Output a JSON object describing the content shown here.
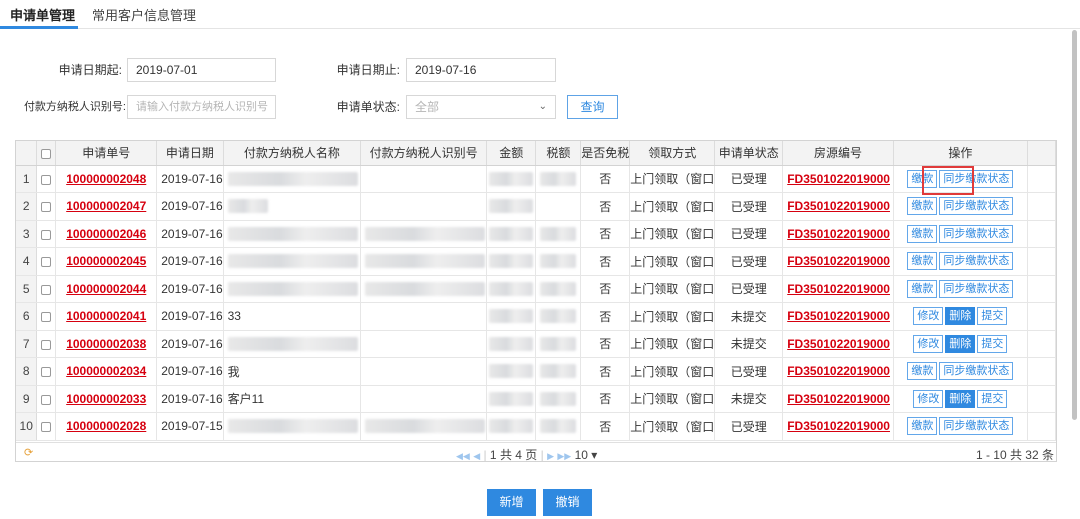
{
  "tabs": [
    {
      "label": "申请单管理",
      "active": true
    },
    {
      "label": "常用客户信息管理",
      "active": false
    }
  ],
  "form": {
    "start_date_label": "申请日期起:",
    "start_date_value": "2019-07-01",
    "end_date_label": "申请日期止:",
    "end_date_value": "2019-07-16",
    "taxpayer_id_label": "付款方纳税人识别号:",
    "taxpayer_id_placeholder": "请输入付款方纳税人识别号",
    "status_label": "申请单状态:",
    "status_value": "全部",
    "query_button": "查询"
  },
  "table": {
    "columns": [
      "申请单号",
      "申请日期",
      "付款方纳税人名称",
      "付款方纳税人识别号",
      "金额",
      "税额",
      "是否免税",
      "领取方式",
      "申请单状态",
      "房源编号",
      "操作"
    ],
    "rows": [
      {
        "n": "1",
        "id": "100000002048",
        "date": "2019-07-16",
        "name": "",
        "exempt": "否",
        "method": "上门领取（窗口",
        "status": "已受理",
        "house": "FD3501022019000",
        "actions": [
          "缴款",
          "同步缴款状态"
        ]
      },
      {
        "n": "2",
        "id": "100000002047",
        "date": "2019-07-16",
        "name": "",
        "exempt": "否",
        "method": "上门领取（窗口",
        "status": "已受理",
        "house": "FD3501022019000",
        "actions": [
          "缴款",
          "同步缴款状态"
        ]
      },
      {
        "n": "3",
        "id": "100000002046",
        "date": "2019-07-16",
        "name": "",
        "exempt": "否",
        "method": "上门领取（窗口",
        "status": "已受理",
        "house": "FD3501022019000",
        "actions": [
          "缴款",
          "同步缴款状态"
        ]
      },
      {
        "n": "4",
        "id": "100000002045",
        "date": "2019-07-16",
        "name": "",
        "exempt": "否",
        "method": "上门领取（窗口",
        "status": "已受理",
        "house": "FD3501022019000",
        "actions": [
          "缴款",
          "同步缴款状态"
        ]
      },
      {
        "n": "5",
        "id": "100000002044",
        "date": "2019-07-16",
        "name": "",
        "exempt": "否",
        "method": "上门领取（窗口",
        "status": "已受理",
        "house": "FD3501022019000",
        "actions": [
          "缴款",
          "同步缴款状态"
        ]
      },
      {
        "n": "6",
        "id": "100000002041",
        "date": "2019-07-16",
        "name": "33",
        "exempt": "否",
        "method": "上门领取（窗口",
        "status": "未提交",
        "house": "FD3501022019000",
        "actions": [
          "修改",
          "删除",
          "提交"
        ]
      },
      {
        "n": "7",
        "id": "100000002038",
        "date": "2019-07-16",
        "name": "",
        "exempt": "否",
        "method": "上门领取（窗口",
        "status": "未提交",
        "house": "FD3501022019000",
        "actions": [
          "修改",
          "删除",
          "提交"
        ]
      },
      {
        "n": "8",
        "id": "100000002034",
        "date": "2019-07-16",
        "name": "我",
        "exempt": "否",
        "method": "上门领取（窗口",
        "status": "已受理",
        "house": "FD3501022019000",
        "actions": [
          "缴款",
          "同步缴款状态"
        ]
      },
      {
        "n": "9",
        "id": "100000002033",
        "date": "2019-07-16",
        "name": "客户11",
        "exempt": "否",
        "method": "上门领取（窗口",
        "status": "未提交",
        "house": "FD3501022019000",
        "actions": [
          "修改",
          "删除",
          "提交"
        ]
      },
      {
        "n": "10",
        "id": "100000002028",
        "date": "2019-07-15",
        "name": "",
        "exempt": "否",
        "method": "上门领取（窗口",
        "status": "已受理",
        "house": "FD3501022019000",
        "actions": [
          "缴款",
          "同步缴款状态"
        ]
      }
    ]
  },
  "pager": {
    "current_page": "1",
    "total_pages_text": "共 4 页",
    "page_size": "10",
    "range_text": "1 - 10  共 32 条"
  },
  "buttons": {
    "add": "新增",
    "revoke": "撤销"
  },
  "colors": {
    "accent": "#2f89e0",
    "link_red": "#d6000f",
    "highlight_box": "#e03a3a"
  }
}
